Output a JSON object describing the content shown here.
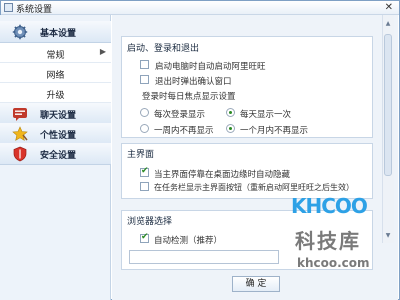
{
  "window": {
    "title": "系统设置",
    "close_label": "✕"
  },
  "sidebar": {
    "categories": [
      {
        "label": "基本设置",
        "icon": "gear-icon"
      },
      {
        "label": "聊天设置",
        "icon": "chat-icon"
      },
      {
        "label": "个性设置",
        "icon": "star-icon"
      },
      {
        "label": "安全设置",
        "icon": "shield-icon"
      }
    ],
    "sub_items": [
      "常规",
      "网络",
      "升级"
    ],
    "selected_sub": "常规"
  },
  "startup": {
    "title": "启动、登录和退出",
    "options": [
      {
        "label": "启动电脑时自动启动阿里旺旺",
        "checked": false
      },
      {
        "label": "退出时弹出确认窗口",
        "checked": false
      }
    ],
    "focus_title": "登录时每日焦点显示设置",
    "radios": [
      {
        "label": "每次登录显示",
        "checked": false
      },
      {
        "label": "每天显示一次",
        "checked": true
      },
      {
        "label": "一周内不再显示",
        "checked": false
      },
      {
        "label": "一个月内不再显示",
        "checked": true
      }
    ]
  },
  "mainpanel": {
    "title": "主界面",
    "options": [
      {
        "label": "当主界面停靠在桌面边缘时自动隐藏",
        "checked": true
      },
      {
        "label": "在任务栏显示主界面按钮（重新启动阿里旺旺之后生效）",
        "checked": false
      }
    ]
  },
  "browser": {
    "title": "浏览器选择",
    "option": {
      "label": "自动检测（推荐）",
      "checked": true
    },
    "path_value": ""
  },
  "footer": {
    "ok_label": "确 定"
  },
  "watermark": {
    "logo": "KHCOO",
    "cn": "科技库",
    "url": "khcoo.com"
  }
}
